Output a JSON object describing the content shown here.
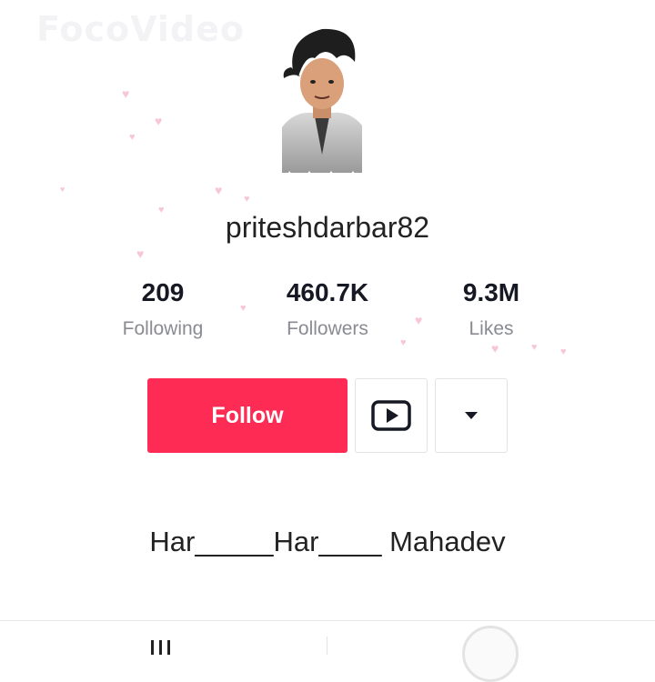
{
  "watermark": "FocoVideo",
  "profile": {
    "username": "priteshdarbar82",
    "bio": "Har_____Har____ Mahadev"
  },
  "stats": [
    {
      "value": "209",
      "label": "Following"
    },
    {
      "value": "460.7K",
      "label": "Followers"
    },
    {
      "value": "9.3M",
      "label": "Likes"
    }
  ],
  "actions": {
    "follow_label": "Follow",
    "youtube_icon": "youtube-icon",
    "dropdown_icon": "caret-down-icon"
  },
  "tabs": [
    {
      "icon": "videos-grid-icon"
    },
    {
      "icon": "liked-icon"
    }
  ],
  "colors": {
    "accent": "#fe2c55",
    "secondary_text": "#8a8b91",
    "heart": "#f7c7d6"
  }
}
